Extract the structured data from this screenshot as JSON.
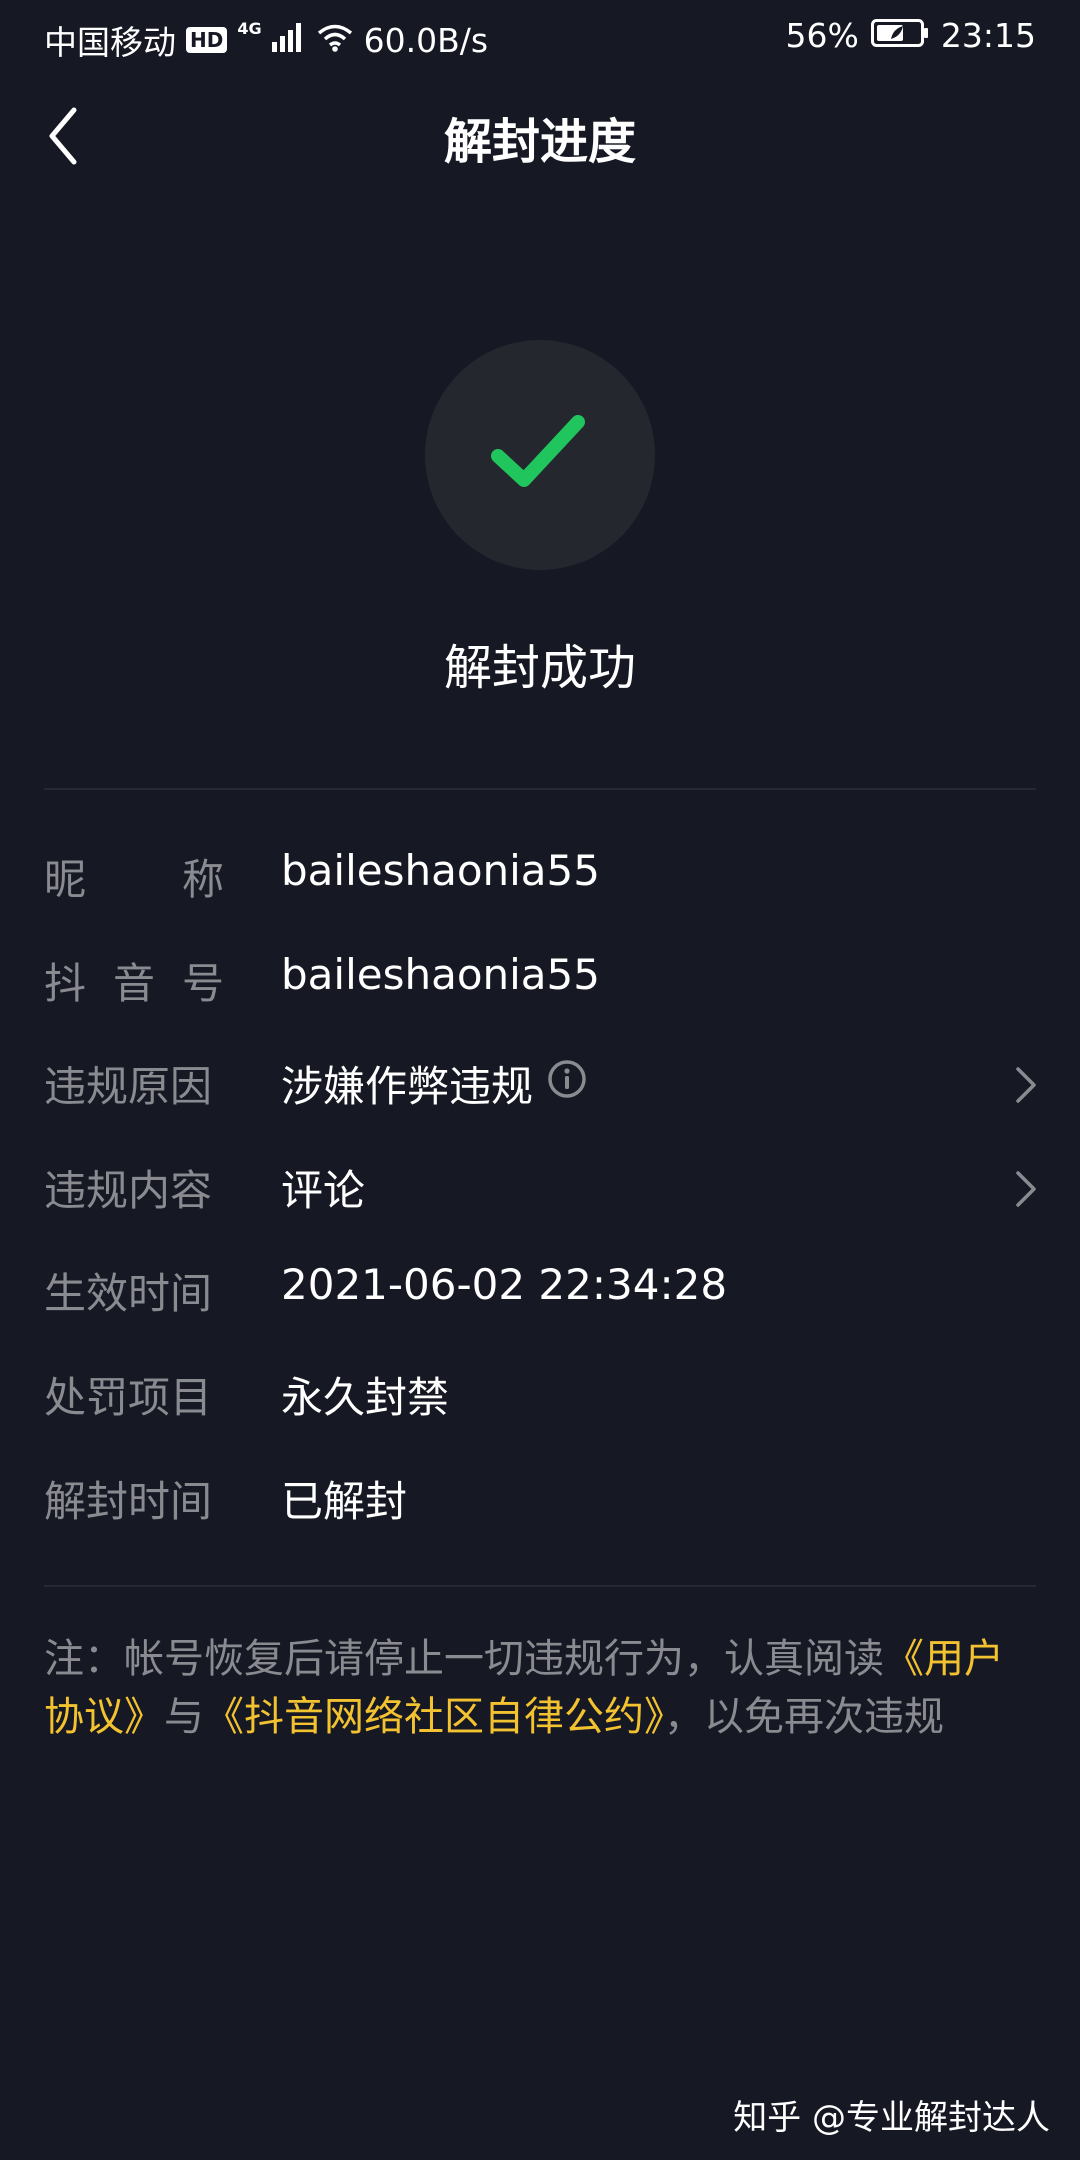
{
  "status_bar": {
    "carrier": "中国移动",
    "hd": "HD",
    "network": "4G",
    "speed": "60.0B/s",
    "battery": "56%",
    "time": "23:15",
    "icons": [
      "hd-icon",
      "signal-icon",
      "wifi-icon",
      "battery-icon"
    ]
  },
  "header": {
    "title": "解封进度",
    "back_icon": "chevron-left-icon"
  },
  "result": {
    "icon": "check-icon",
    "icon_color": "#21c55d",
    "text": "解封成功"
  },
  "info": [
    {
      "label": "昵称",
      "label_chars": [
        "昵",
        "称"
      ],
      "value": "baileshaonia55"
    },
    {
      "label": "抖音号",
      "label_chars": [
        "抖",
        "音",
        "号"
      ],
      "value": "baileshaonia55"
    },
    {
      "label": "违规原因",
      "value": "涉嫌作弊违规",
      "has_info_icon": true,
      "has_chevron": true
    },
    {
      "label": "违规内容",
      "value": "评论",
      "has_chevron": true
    },
    {
      "label": "生效时间",
      "value": "2021-06-02 22:34:28"
    },
    {
      "label": "处罚项目",
      "value": "永久封禁"
    },
    {
      "label": "解封时间",
      "value": "已解封"
    }
  ],
  "note": {
    "prefix": "注：帐号恢复后请停止一切违规行为，认真阅读",
    "link1": "《用户协议》",
    "middle": "与",
    "link2": "《抖音网络社区自律公约》",
    "suffix": "，以免再次违规"
  },
  "watermark": "知乎 @专业解封达人",
  "colors": {
    "background": "#161823",
    "label": "#8a8b91",
    "accent_link": "#f2c230",
    "success": "#21c55d"
  }
}
